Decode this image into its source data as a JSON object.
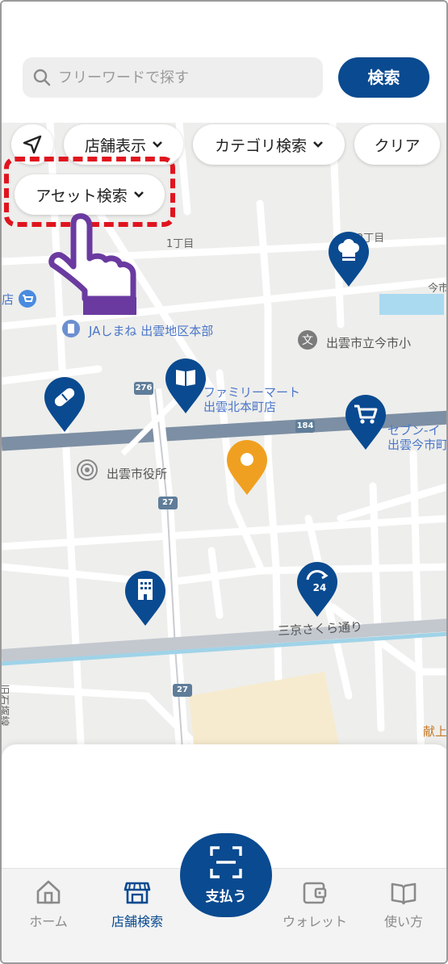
{
  "search": {
    "placeholder": "フリーワードで探す",
    "button_label": "検索"
  },
  "filters": {
    "store_display": "店舗表示",
    "category_search": "カテゴリ検索",
    "clear": "クリア",
    "asset_search": "アセット検索"
  },
  "map": {
    "labels": {
      "chome1": "1丁目",
      "chome2": "2丁目",
      "ima": "今市",
      "ja": "JAしまね 出雲地区本部",
      "school": "出雲市立今市小",
      "familymart_1": "ファミリーマート",
      "familymart_2": "出雲北本町店",
      "seven_1": "セブン-イ",
      "seven_2": "出雲今市町",
      "cityhall": "出雲市役所",
      "street": "三京さくら通り",
      "kenjo": "献上",
      "side": "旧石塚線",
      "store_left": "店"
    },
    "routes": {
      "r276": "276",
      "r184": "184",
      "r27a": "27",
      "r27b": "27"
    }
  },
  "pins": [
    {
      "name": "restaurant-pin",
      "icon": "chef-hat-icon",
      "color": "#0a4a90"
    },
    {
      "name": "book-pin",
      "icon": "book-icon",
      "color": "#0a4a90"
    },
    {
      "name": "pharmacy-pin",
      "icon": "pill-icon",
      "color": "#0a4a90"
    },
    {
      "name": "shopping-pin",
      "icon": "cart-icon",
      "color": "#0a4a90"
    },
    {
      "name": "current-location-pin",
      "icon": "location-dot-icon",
      "color": "#f0a020"
    },
    {
      "name": "building-pin",
      "icon": "building-icon",
      "color": "#0a4a90"
    },
    {
      "name": "24h-pin",
      "icon": "24h-icon",
      "color": "#0a4a90"
    }
  ],
  "nav": {
    "home": "ホーム",
    "store_search": "店舗検索",
    "pay": "支払う",
    "wallet": "ウォレット",
    "usage": "使い方"
  },
  "colors": {
    "brand": "#0a4a90",
    "highlight": "#e0141e",
    "hand": "#6a3aa0",
    "current": "#f0a020"
  }
}
